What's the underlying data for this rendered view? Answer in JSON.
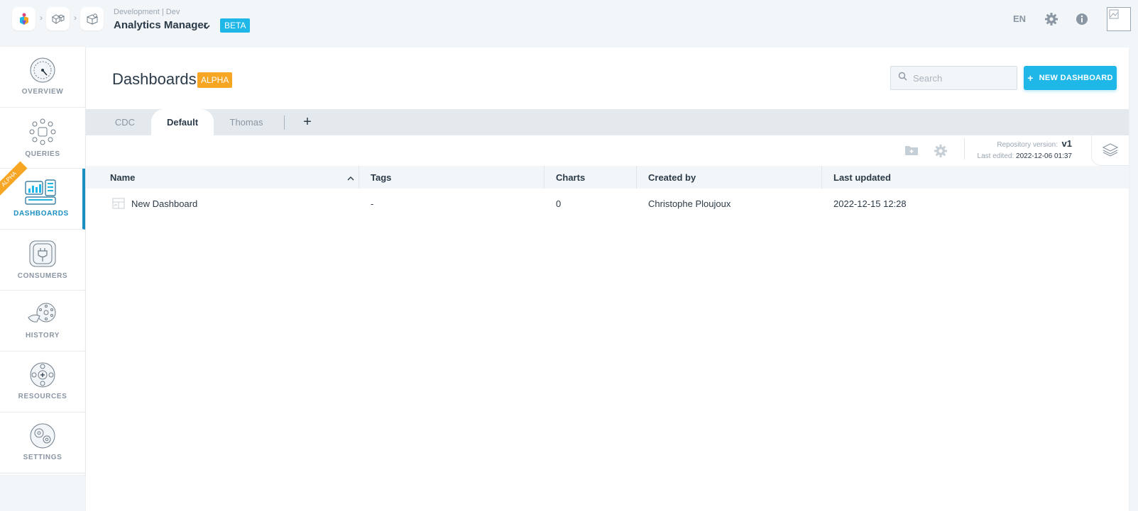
{
  "header": {
    "env_label": "Development | Dev",
    "app_name": "Analytics Manager",
    "beta_badge": "BETA",
    "language": "EN"
  },
  "sidebar": {
    "items": [
      {
        "label": "OVERVIEW",
        "icon": "gauge-icon",
        "active": false
      },
      {
        "label": "QUERIES",
        "icon": "network-icon",
        "active": false
      },
      {
        "label": "DASHBOARDS",
        "icon": "dashboard-charts-icon",
        "active": true,
        "ribbon": "ALPHA"
      },
      {
        "label": "CONSUMERS",
        "icon": "plug-icon",
        "active": false
      },
      {
        "label": "HISTORY",
        "icon": "history-icon",
        "active": false
      },
      {
        "label": "RESOURCES",
        "icon": "resources-icon",
        "active": false
      },
      {
        "label": "SETTINGS",
        "icon": "settings-gears-icon",
        "active": false
      }
    ]
  },
  "page": {
    "title": "Dashboards",
    "alpha_badge": "ALPHA",
    "search_placeholder": "Search",
    "new_button_label": "NEW DASHBOARD"
  },
  "tabs": [
    {
      "label": "CDC",
      "active": false
    },
    {
      "label": "Default",
      "active": true
    },
    {
      "label": "Thomas",
      "active": false
    }
  ],
  "tab_add_label": "+",
  "repository": {
    "version_label": "Repository version:",
    "version_value": "v1",
    "edited_label": "Last edited:",
    "edited_value": "2022-12-06 01:37"
  },
  "table": {
    "columns": [
      "Name",
      "Tags",
      "Charts",
      "Created by",
      "Last updated"
    ],
    "rows": [
      {
        "name": "New Dashboard",
        "tags": "-",
        "charts": "0",
        "created_by": "Christophe Ploujoux",
        "last_updated": "2022-12-15 12:28"
      }
    ]
  },
  "colors": {
    "accent": "#1fb6e8",
    "alpha": "#f6a623",
    "active_nav": "#1a8fc1"
  }
}
